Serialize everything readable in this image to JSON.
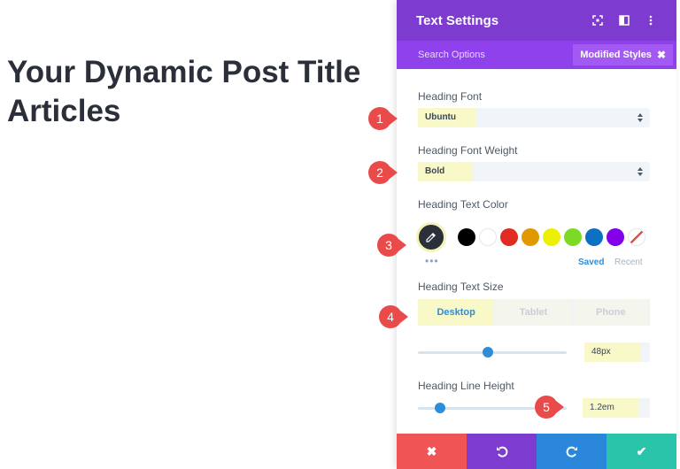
{
  "post_title": {
    "line1": "Your Dynamic Post Title",
    "line2": "Articles"
  },
  "panel": {
    "title": "Text Settings",
    "search_placeholder": "Search Options",
    "modified_styles": "Modified Styles",
    "heading_font": {
      "label": "Heading Font",
      "value": "Ubuntu"
    },
    "heading_font_weight": {
      "label": "Heading Font Weight",
      "value": "Bold"
    },
    "heading_text_color": {
      "label": "Heading Text Color",
      "saved": "Saved",
      "recent": "Recent",
      "swatches": [
        "#000000",
        "#ffffff",
        "#e02b20",
        "#e09900",
        "#edf000",
        "#7cda24",
        "#0c71c3",
        "#8300e9"
      ]
    },
    "heading_text_size": {
      "label": "Heading Text Size",
      "tabs": [
        "Desktop",
        "Tablet",
        "Phone"
      ],
      "value": "48px",
      "slider_fraction": 0.47
    },
    "heading_line_height": {
      "label": "Heading Line Height",
      "value": "1.2em",
      "slider_fraction": 0.15
    }
  },
  "markers": [
    "1",
    "2",
    "3",
    "4",
    "5"
  ],
  "colors": {
    "header": "#7e3bd0",
    "subbar": "#8f42ec",
    "cancel": "#ef5555",
    "undo": "#7e3bd0",
    "redo": "#2b87da",
    "save": "#29c4a9",
    "marker": "#e94b4b",
    "highlight": "#f8f8c9"
  }
}
